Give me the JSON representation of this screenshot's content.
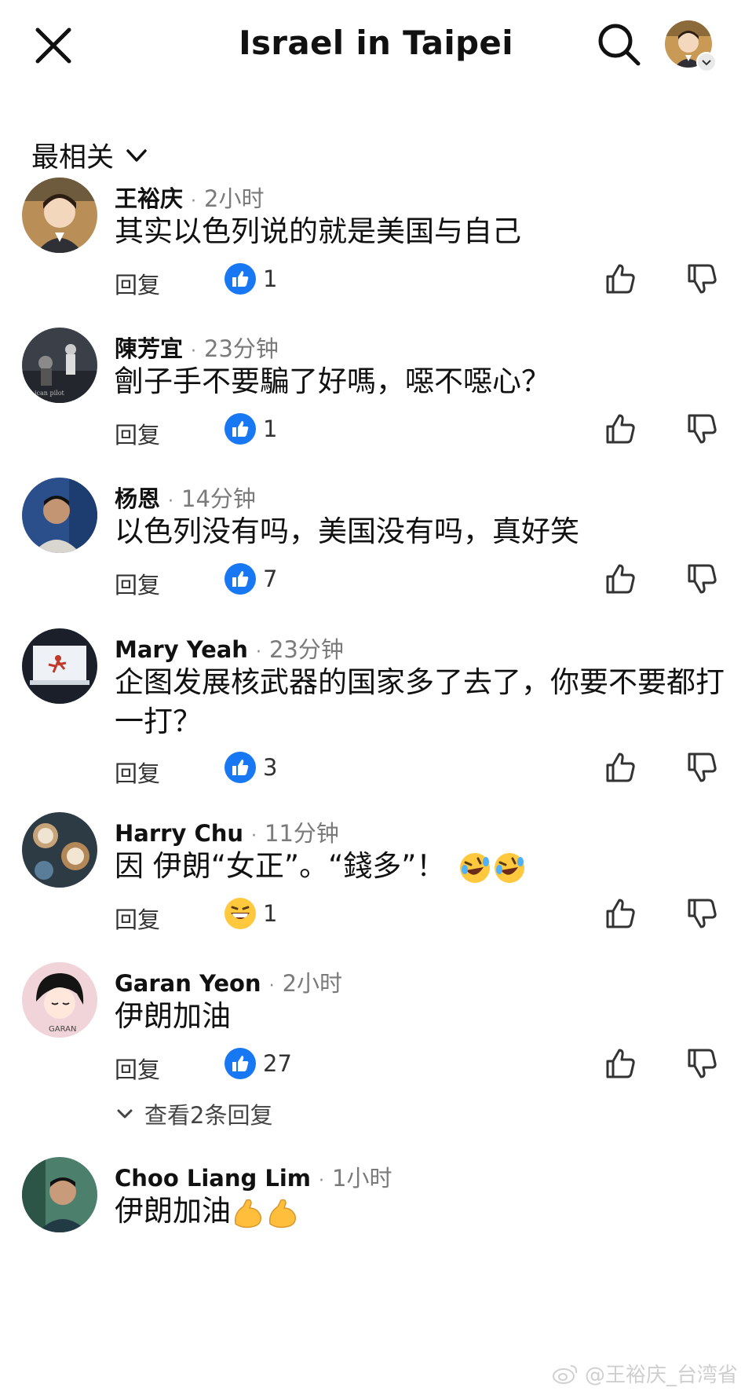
{
  "header": {
    "title": "Israel in Taipei"
  },
  "sort": {
    "label": "最相关"
  },
  "reply_label": "回复",
  "comments": [
    {
      "author": "王裕庆",
      "time": "2小时",
      "text": "其实以色列说的就是美国与自己",
      "reaction": "like",
      "count": "1"
    },
    {
      "author": "陳芳宜",
      "time": "23分钟",
      "text": "劊子手不要騙了好嗎，噁不噁心？",
      "reaction": "like",
      "count": "1"
    },
    {
      "author": "杨恩",
      "time": "14分钟",
      "text": "以色列没有吗，美国没有吗，真好笑",
      "reaction": "like",
      "count": "7"
    },
    {
      "author": "Mary Yeah",
      "time": "23分钟",
      "text": "企图发展核武器的国家多了去了，你要不要都打一打？",
      "reaction": "like",
      "count": "3"
    },
    {
      "author": "Harry Chu",
      "time": "11分钟",
      "text": "因 伊朗“女正”。“錢多”！",
      "reaction": "haha",
      "count": "1"
    },
    {
      "author": "Garan Yeon",
      "time": "2小时",
      "text": "伊朗加油",
      "reaction": "like",
      "count": "27",
      "view_replies": "查看2条回复"
    },
    {
      "author": "Choo Liang Lim",
      "time": "1小时",
      "text": "伊朗加油"
    }
  ],
  "watermark": "@王裕庆_台湾省",
  "icons": {
    "close": "close-icon",
    "search": "search-icon",
    "like_reaction": "blue-thumbs-up",
    "haha_reaction": "grinning-face",
    "laughing": "rolling-on-floor-laughing",
    "flexed": "flexed-biceps"
  },
  "colors": {
    "like_blue": "#1877F2",
    "text": "#111111",
    "muted": "#7a7a7a"
  }
}
